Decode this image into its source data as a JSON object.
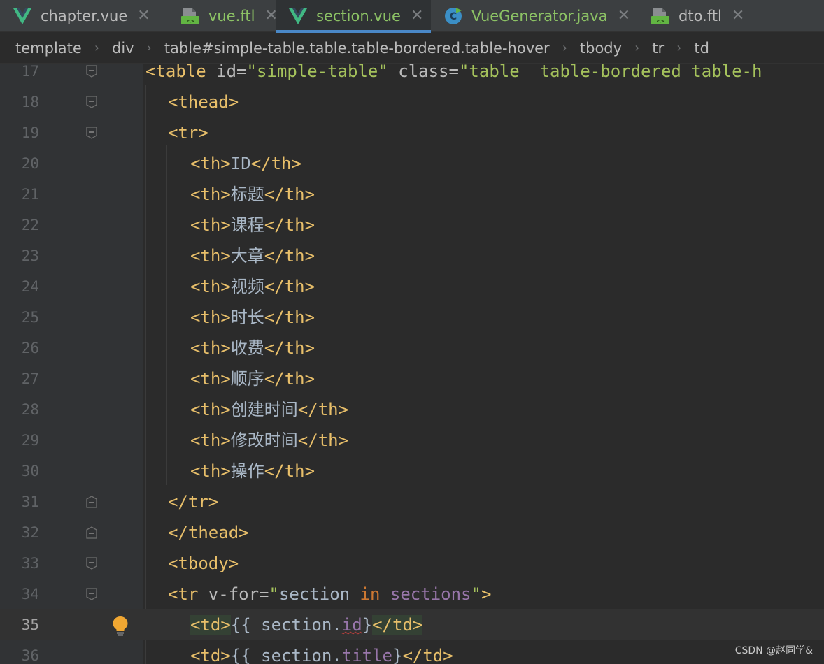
{
  "tabs": [
    {
      "label": "chapter.vue",
      "icon": "vue-icon",
      "active": false
    },
    {
      "label": "vue.ftl",
      "icon": "freemarker-file-icon",
      "active": false
    },
    {
      "label": "section.vue",
      "icon": "vue-icon",
      "active": true
    },
    {
      "label": "VueGenerator.java",
      "icon": "java-class-icon",
      "active": false
    },
    {
      "label": "dto.ftl",
      "icon": "freemarker-file-icon",
      "active": false
    }
  ],
  "breadcrumb": [
    "template",
    "div",
    "table#simple-table.table.table-bordered.table-hover",
    "tbody",
    "tr",
    "td"
  ],
  "line_numbers": [
    "17",
    "18",
    "19",
    "20",
    "21",
    "22",
    "23",
    "24",
    "25",
    "26",
    "27",
    "28",
    "29",
    "30",
    "31",
    "32",
    "33",
    "34",
    "35",
    "36"
  ],
  "code": {
    "l17": {
      "open": "<table ",
      "a1": "id=",
      "s1": "\"simple-table\"",
      "a2": " class=",
      "s2": "\"table  table-bordered table-h"
    },
    "l18": "<thead>",
    "l19": "<tr>",
    "th_open": "<th>",
    "th_close": "</th>",
    "headers": [
      "ID",
      "标题",
      "课程",
      "大章",
      "视频",
      "时长",
      "收费",
      "顺序",
      "创建时间",
      "修改时间",
      "操作"
    ],
    "l31": "</tr>",
    "l32": "</thead>",
    "l33": "<tbody>",
    "l34": {
      "open": "<tr ",
      "a1": "v-for=",
      "q1": "\"",
      "v1": "section ",
      "k1": "in ",
      "v2": "sections",
      "q2": "\"",
      "close": ">"
    },
    "l35": {
      "open": "<td>",
      "t1": "{{ section.",
      "p1": "id",
      "t2": "}",
      "close": "</td>"
    },
    "l36": {
      "open": "<td>",
      "t1": "{{ section.",
      "p1": "title",
      "t2": "}",
      "close": "</td>"
    }
  },
  "watermark": "CSDN @赵同学&"
}
